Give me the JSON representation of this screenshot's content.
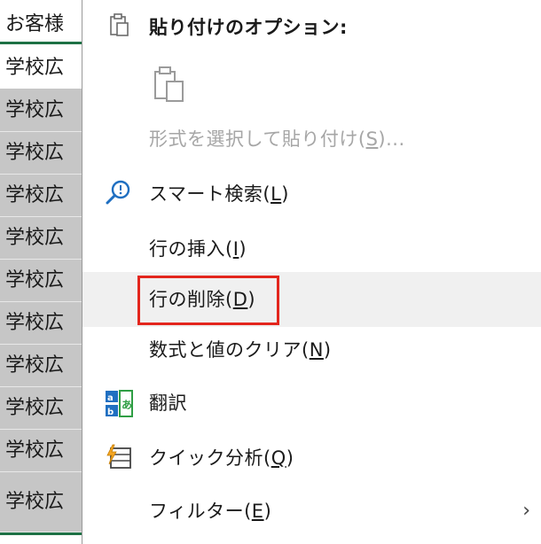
{
  "sheet": {
    "header": "お客様",
    "rows": [
      "学校広",
      "学校広",
      "学校広",
      "学校広",
      "学校広",
      "学校広",
      "学校広",
      "学校広",
      "学校広",
      "学校広",
      "学校広"
    ]
  },
  "menu": {
    "paste_options_label": "貼り付けのオプション:",
    "paste_special": {
      "text": "形式を選択して貼り付け(",
      "key": "S",
      "suffix": ")..."
    },
    "smart_lookup": {
      "text": "スマート検索(",
      "key": "L",
      "suffix": ")"
    },
    "insert_row": {
      "text": "行の挿入(",
      "key": "I",
      "suffix": ")"
    },
    "delete_row": {
      "text": "行の削除(",
      "key": "D",
      "suffix": ")"
    },
    "clear_contents": {
      "text": "数式と値のクリア(",
      "key": "N",
      "suffix": ")"
    },
    "translate": {
      "text": "翻訳"
    },
    "quick_analysis": {
      "text": "クイック分析(",
      "key": "Q",
      "suffix": ")"
    },
    "filter": {
      "text": "フィルター(",
      "key": "E",
      "suffix": ")"
    },
    "submenu_chevron": "›"
  },
  "icons": {
    "paste_header": "clipboard-icon",
    "paste_option": "clipboard-paste-icon",
    "smart_lookup": "search-bulb-icon",
    "translate": "translate-icon",
    "quick_analysis": "quick-analysis-icon"
  },
  "colors": {
    "excel_green": "#1e7145",
    "selected_cell": "#c6c6c6",
    "hover_row": "#f0f0f0",
    "highlight_red": "#e3261d",
    "icon_blue": "#1f6fc1",
    "disabled_text": "#a6a6a6"
  }
}
